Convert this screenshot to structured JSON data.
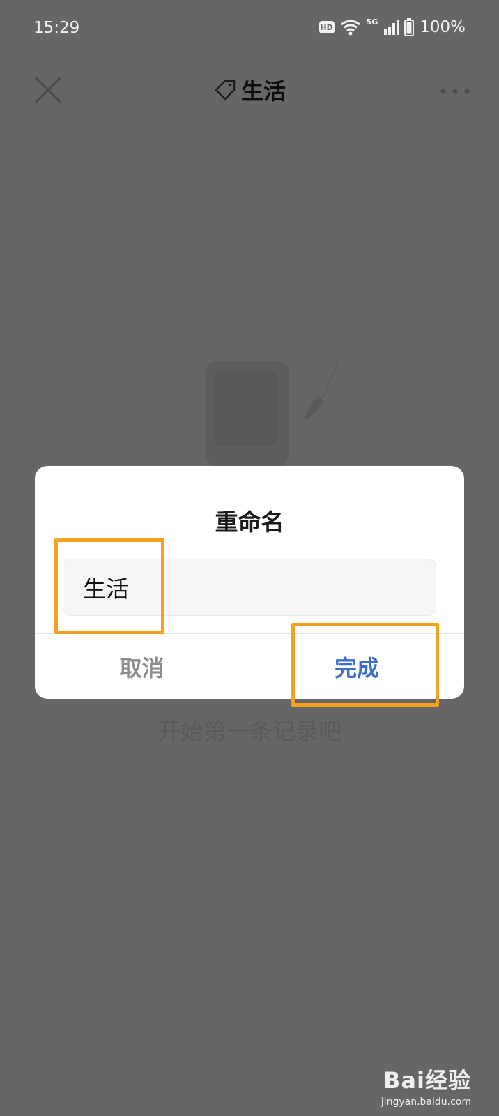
{
  "status_bar": {
    "time": "15:29",
    "hd": "HD",
    "network": "5G",
    "battery": "100%",
    "icons": [
      "wifi-icon",
      "signal-icon",
      "battery-icon"
    ]
  },
  "header": {
    "title": "生活",
    "title_icon": "tag-icon",
    "close_icon": "close-icon",
    "more_icon": "more-icon"
  },
  "empty_state": {
    "illustration": "note-brush-illustration",
    "text": "开始第一条记录吧"
  },
  "dialog": {
    "title": "重命名",
    "input_value": "生活",
    "cancel_label": "取消",
    "done_label": "完成"
  },
  "annotations": {
    "highlight_color": "#f4a21d"
  },
  "watermark": {
    "logo": "Bai经验",
    "url": "jingyan.baidu.com"
  },
  "colors": {
    "overlay": "#666666",
    "accent": "#3e6fd0",
    "cancel": "#8c8c8c"
  }
}
